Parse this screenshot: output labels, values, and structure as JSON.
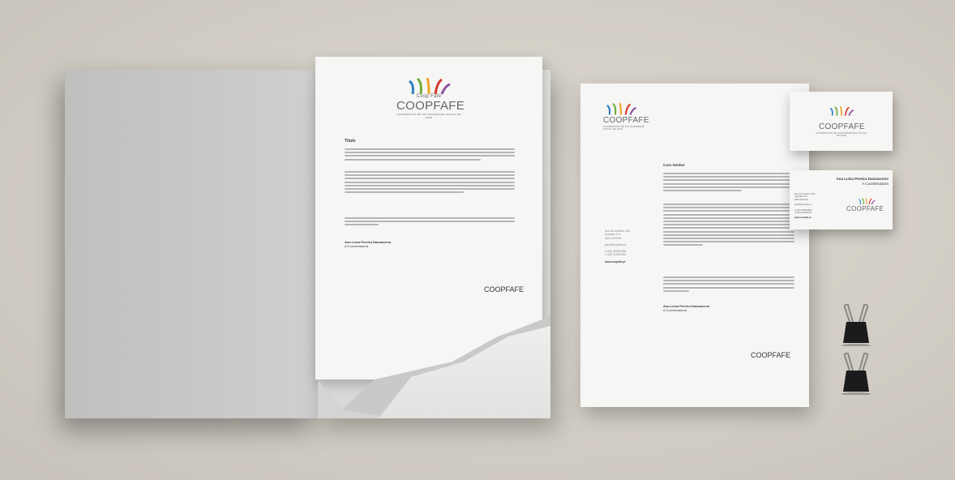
{
  "colors": {
    "background": "#d8d3ca",
    "folder": "#c8c8c6",
    "paper": "#f6f6f4",
    "logo_red": "#d93a2f",
    "logo_orange": "#f0a22a",
    "logo_green": "#6fae3b",
    "logo_blue": "#2f7fc2",
    "logo_purple": "#8a4f9e"
  },
  "brand": {
    "name": "COOPFAFE",
    "tagline_top": "Coop Fafe",
    "subtitle": "COOPERATIVA DE SOLIDARIEDADE SOCIAL DE FAFE"
  },
  "letter_main": {
    "heading": "Título",
    "signature_name": "Ana Luísa Pereira Damasceno",
    "signature_role": "A Coordenadora",
    "footer_brand": "COOPFAFE"
  },
  "letter_right": {
    "greeting": "Caro Senhor",
    "address_lines": [
      "Rua da Cumieira, 606",
      "Apartado 114",
      "4820-183 Fafe"
    ],
    "email": "geral@coopfafe.pt",
    "phones": [
      "(+351) 253590860",
      "(+351) 913562532"
    ],
    "website": "www.coopfafe.pt",
    "signature_name": "Ana Luísa Pereira Damasceno",
    "signature_role": "A Coordenadora",
    "footer_brand": "COOPFAFE"
  },
  "card_back": {
    "name": "Ana Luísa Pereira Damasceno",
    "role": "A Coordenadora",
    "address_lines": [
      "Rua da Cumieira, 606",
      "Apartado 114",
      "4820-183 Fafe"
    ],
    "email": "geral@coopfafe.pt",
    "phones": [
      "(+351) 253590860",
      "(+351) 913562532"
    ],
    "website": "www.coopfafe.pt"
  },
  "icons": [
    "coopfafe-logo-icon",
    "binder-clip-icon"
  ]
}
